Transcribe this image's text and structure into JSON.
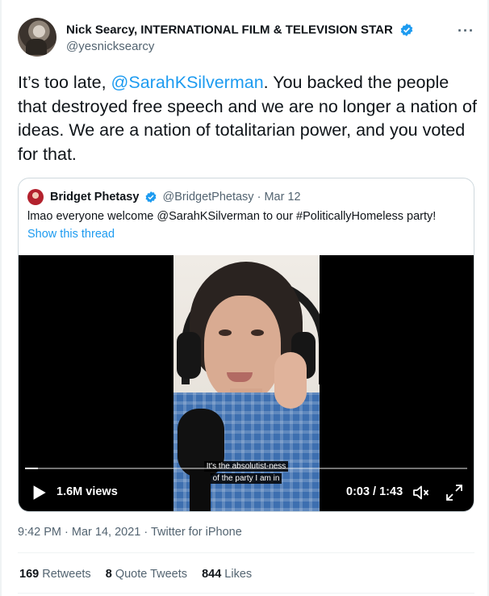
{
  "author": {
    "name": "Nick Searcy, INTERNATIONAL FILM & TELEVISION STAR",
    "handle": "@yesnicksearcy",
    "more_label": "···"
  },
  "tweet": {
    "text_before": "It’s too late, ",
    "mention": "@SarahKSilverman",
    "text_after": ". You backed the people that destroyed free speech and we are no longer a nation of ideas. We are a nation of totalitarian power, and you voted for that."
  },
  "quoted": {
    "name": "Bridget Phetasy",
    "handle": "@BridgetPhetasy",
    "date": "· Mar 12",
    "text": "lmao everyone welcome @SarahKSilverman to our #PoliticallyHomeless party!",
    "show_thread": "Show this thread",
    "video": {
      "subtitle_line1": "It's the absolutist-ness",
      "subtitle_line2": "of the party I am in",
      "views": "1.6M views",
      "time": "0:03 / 1:43",
      "progress": 0.03
    }
  },
  "meta": "9:42 PM · Mar 14, 2021 · Twitter for iPhone",
  "stats": {
    "retweets_count": "169",
    "retweets_label": "Retweets",
    "quotes_count": "8",
    "quotes_label": "Quote Tweets",
    "likes_count": "844",
    "likes_label": "Likes"
  },
  "colors": {
    "accent": "#1d9bf0",
    "secondary_text": "#536471"
  }
}
